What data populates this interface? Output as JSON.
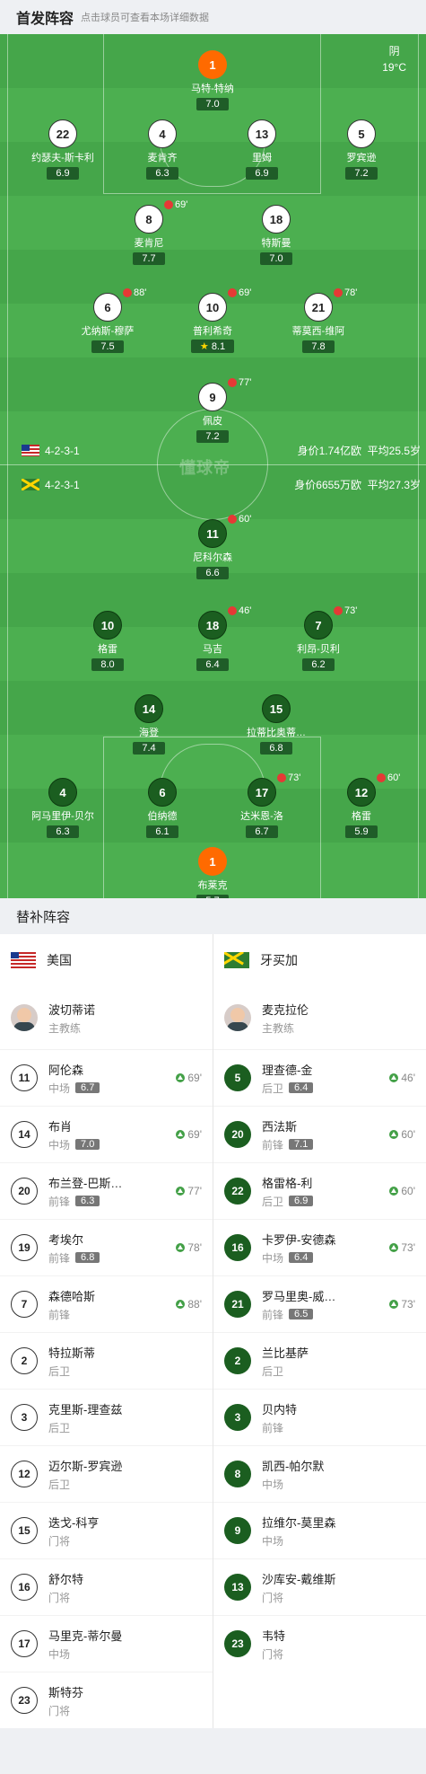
{
  "header": {
    "title": "首发阵容",
    "hint": "点击球员可查看本场详细数据"
  },
  "weather": {
    "condition": "阴",
    "temp": "19°C"
  },
  "watermark": "懂球帝",
  "home": {
    "formation": "4-2-3-1",
    "value": "身价1.74亿欧",
    "age": "平均25.5岁",
    "players": [
      {
        "num": "1",
        "name": "马特-特纳",
        "rating": "7.0",
        "gk": true
      },
      {
        "num": "22",
        "name": "约瑟夫-斯卡利",
        "rating": "6.9"
      },
      {
        "num": "4",
        "name": "麦肯齐",
        "rating": "6.3"
      },
      {
        "num": "13",
        "name": "里姆",
        "rating": "6.9",
        "captain": true
      },
      {
        "num": "5",
        "name": "罗宾逊",
        "rating": "7.2"
      },
      {
        "num": "8",
        "name": "麦肯尼",
        "rating": "7.7",
        "sub": "69'"
      },
      {
        "num": "18",
        "name": "特斯曼",
        "rating": "7.0"
      },
      {
        "num": "6",
        "name": "尤纳斯-穆萨",
        "rating": "7.5",
        "sub": "88'"
      },
      {
        "num": "10",
        "name": "普利希奇",
        "rating": "8.1",
        "sub": "69'",
        "star": true
      },
      {
        "num": "21",
        "name": "蒂莫西-维阿",
        "rating": "7.8",
        "sub": "78'"
      },
      {
        "num": "9",
        "name": "佩皮",
        "rating": "7.2",
        "sub": "77'"
      }
    ]
  },
  "away": {
    "formation": "4-2-3-1",
    "value": "身价6655万欧",
    "age": "平均27.3岁",
    "players": [
      {
        "num": "11",
        "name": "尼科尔森",
        "rating": "6.6",
        "sub": "60'"
      },
      {
        "num": "10",
        "name": "格雷",
        "rating": "8.0"
      },
      {
        "num": "18",
        "name": "马吉",
        "rating": "6.4",
        "sub": "46'"
      },
      {
        "num": "7",
        "name": "利昂-贝利",
        "rating": "6.2",
        "sub": "73'"
      },
      {
        "num": "14",
        "name": "海登",
        "rating": "7.4"
      },
      {
        "num": "15",
        "name": "拉蒂比奥蒂…",
        "rating": "6.8"
      },
      {
        "num": "4",
        "name": "阿马里伊-贝尔",
        "rating": "6.3"
      },
      {
        "num": "6",
        "name": "伯纳德",
        "rating": "6.1"
      },
      {
        "num": "17",
        "name": "达米恩-洛",
        "rating": "6.7",
        "sub": "73'"
      },
      {
        "num": "12",
        "name": "格雷",
        "rating": "5.9",
        "sub": "60'"
      },
      {
        "num": "1",
        "name": "布莱克",
        "rating": "5.7",
        "gk": true,
        "captain": true
      }
    ]
  },
  "subs": {
    "title": "替补阵容",
    "home": {
      "team": "美国",
      "coach": {
        "name": "波切蒂诺",
        "role": "主教练"
      },
      "list": [
        {
          "num": "11",
          "name": "阿伦森",
          "pos": "中场",
          "rating": "6.7",
          "minute": "69'"
        },
        {
          "num": "14",
          "name": "布肖",
          "pos": "中场",
          "rating": "7.0",
          "minute": "69'"
        },
        {
          "num": "20",
          "name": "布兰登-巴斯…",
          "pos": "前锋",
          "rating": "6.3",
          "minute": "77'"
        },
        {
          "num": "19",
          "name": "考埃尔",
          "pos": "前锋",
          "rating": "6.8",
          "minute": "78'"
        },
        {
          "num": "7",
          "name": "森德哈斯",
          "pos": "前锋",
          "rating": "",
          "minute": "88'"
        },
        {
          "num": "2",
          "name": "特拉斯蒂",
          "pos": "后卫",
          "rating": "",
          "minute": ""
        },
        {
          "num": "3",
          "name": "克里斯-理查兹",
          "pos": "后卫",
          "rating": "",
          "minute": ""
        },
        {
          "num": "12",
          "name": "迈尔斯-罗宾逊",
          "pos": "后卫",
          "rating": "",
          "minute": ""
        },
        {
          "num": "15",
          "name": "迭戈-科亨",
          "pos": "门将",
          "rating": "",
          "minute": ""
        },
        {
          "num": "16",
          "name": "舒尔特",
          "pos": "门将",
          "rating": "",
          "minute": ""
        },
        {
          "num": "17",
          "name": "马里克-蒂尔曼",
          "pos": "中场",
          "rating": "",
          "minute": ""
        },
        {
          "num": "23",
          "name": "斯特芬",
          "pos": "门将",
          "rating": "",
          "minute": ""
        }
      ]
    },
    "away": {
      "team": "牙买加",
      "coach": {
        "name": "麦克拉伦",
        "role": "主教练"
      },
      "list": [
        {
          "num": "5",
          "name": "理查德-金",
          "pos": "后卫",
          "rating": "6.4",
          "minute": "46'"
        },
        {
          "num": "20",
          "name": "西法斯",
          "pos": "前锋",
          "rating": "7.1",
          "minute": "60'"
        },
        {
          "num": "22",
          "name": "格雷格-利",
          "pos": "后卫",
          "rating": "6.9",
          "minute": "60'"
        },
        {
          "num": "16",
          "name": "卡罗伊-安德森",
          "pos": "中场",
          "rating": "6.4",
          "minute": "73'"
        },
        {
          "num": "21",
          "name": "罗马里奥-威…",
          "pos": "前锋",
          "rating": "6.5",
          "minute": "73'"
        },
        {
          "num": "2",
          "name": "兰比基萨",
          "pos": "后卫",
          "rating": "",
          "minute": ""
        },
        {
          "num": "3",
          "name": "贝内特",
          "pos": "前锋",
          "rating": "",
          "minute": ""
        },
        {
          "num": "8",
          "name": "凯西-帕尔默",
          "pos": "中场",
          "rating": "",
          "minute": ""
        },
        {
          "num": "9",
          "name": "拉维尔-莫里森",
          "pos": "中场",
          "rating": "",
          "minute": ""
        },
        {
          "num": "13",
          "name": "沙库安-戴维斯",
          "pos": "门将",
          "rating": "",
          "minute": ""
        },
        {
          "num": "23",
          "name": "韦特",
          "pos": "门将",
          "rating": "",
          "minute": ""
        }
      ]
    }
  },
  "colors": {
    "pitch": "#4caf50",
    "home_kit": "#ffffff",
    "away_kit": "#1b5e20",
    "gk": "#ff6a00"
  },
  "icons": [
    "us-flag-icon",
    "jamaica-flag-icon",
    "sub-off-icon",
    "sub-on-icon",
    "captain-icon",
    "goal-ball-icon",
    "star-icon"
  ]
}
